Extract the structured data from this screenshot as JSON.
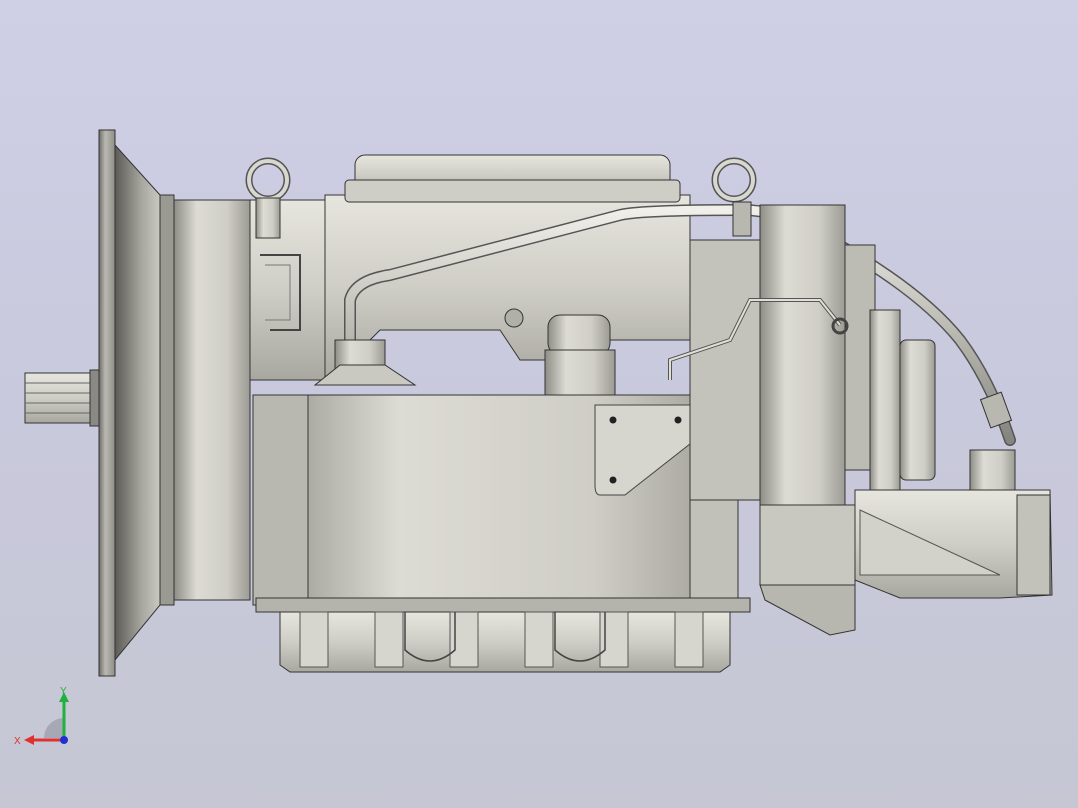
{
  "viewport": {
    "background_top": "#cfcfe6",
    "background_bottom": "#c6c7d3"
  },
  "model": {
    "subject": "gearbox-assembly-side-view",
    "body_color": "#d4d3cc",
    "edge_color": "#3a3a3a"
  },
  "triad": {
    "x_label": "X",
    "y_label": "Y",
    "x_color": "#e03030",
    "y_color": "#20b040",
    "z_color": "#2030d0"
  }
}
